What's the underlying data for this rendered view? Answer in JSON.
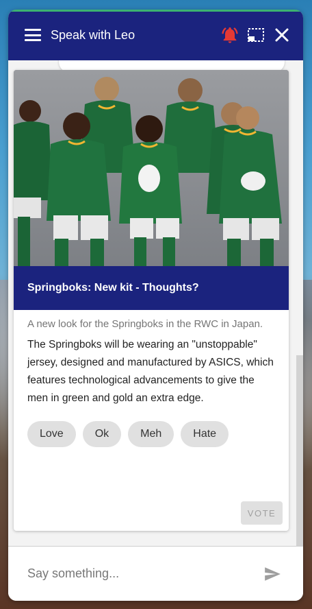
{
  "header": {
    "title": "Speak with Leo",
    "icons": [
      "menu-icon",
      "bell-alert-icon",
      "fullscreen-icon",
      "close-icon"
    ],
    "accent_color": "#1b237e",
    "alert_color": "#e53935"
  },
  "card": {
    "title": "Springboks: New kit - Thoughts?",
    "subtitle": "A new look for the Springboks in the RWC in Japan.",
    "description": "The Springboks will be wearing an \"unstoppable\" jersey, designed and manufactured by ASICS, which features technological advancements to give the men in green and gold an extra edge.",
    "options": [
      "Love",
      "Ok",
      "Meh",
      "Hate"
    ],
    "vote_label": "VOTE"
  },
  "composer": {
    "placeholder": "Say something...",
    "send_icon": "send-icon"
  }
}
